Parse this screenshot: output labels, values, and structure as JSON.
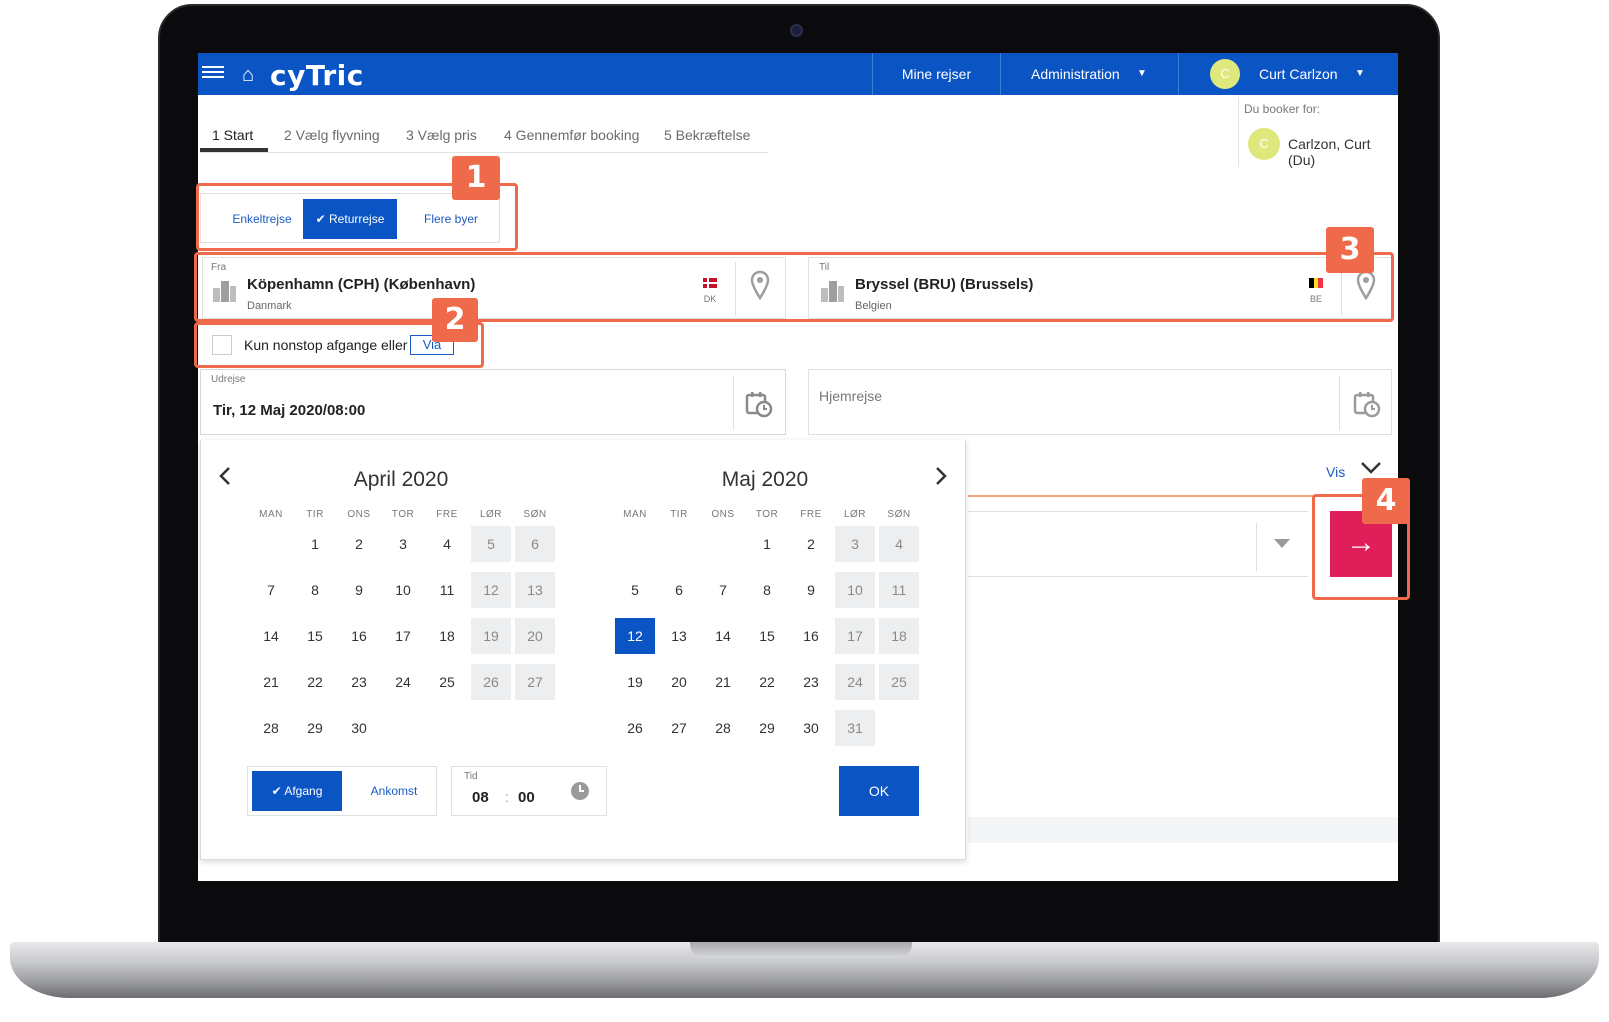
{
  "header": {
    "logo": "cyTric",
    "nav_my_trips": "Mine rejser",
    "nav_admin": "Administration",
    "user_name": "Curt Carlzon",
    "user_initial": "C"
  },
  "steps": [
    {
      "label": "1 Start"
    },
    {
      "label": "2 Vælg flyvning"
    },
    {
      "label": "3 Vælg pris"
    },
    {
      "label": "4 Gennemfør booking"
    },
    {
      "label": "5 Bekræftelse"
    }
  ],
  "booker": {
    "label": "Du booker for:",
    "initial": "C",
    "name": "Carlzon, Curt (Du)"
  },
  "trip_type": {
    "one_way": "Enkeltrejse",
    "return": "Returrejse",
    "multi_city": "Flere byer",
    "selected": "Returrejse"
  },
  "from": {
    "label": "Fra",
    "name": "Köpenhamn (CPH) (København)",
    "country": "Danmark",
    "flag_code": "DK"
  },
  "to": {
    "label": "Til",
    "name": "Bryssel (BRU) (Brussels)",
    "country": "Belgien",
    "flag_code": "BE"
  },
  "nonstop": {
    "label": "Kun nonstop afgange",
    "or_text": "eller",
    "via_label": "Via",
    "checked": false
  },
  "departure": {
    "label": "Udrejse",
    "value": "Tir, 12 Maj 2020/08:00"
  },
  "return_date": {
    "placeholder": "Hjemrejse"
  },
  "options": {
    "vis_label": "Vis"
  },
  "calendar": {
    "weekdays": [
      "MAN",
      "TIR",
      "ONS",
      "TOR",
      "FRE",
      "LØR",
      "SØN"
    ],
    "months": [
      {
        "title": "April 2020",
        "first_weekday": 2,
        "days": 30
      },
      {
        "title": "Maj 2020",
        "first_weekday": 4,
        "days": 31
      }
    ],
    "selected_month": 1,
    "selected_day": 12,
    "mode": {
      "departure": "Afgang",
      "arrival": "Ankomst",
      "selected": "Afgang"
    },
    "time": {
      "label": "Tid",
      "hours": "08",
      "minutes": "00"
    },
    "ok_label": "OK"
  },
  "annotations": [
    "1",
    "2",
    "3",
    "4"
  ],
  "colors": {
    "primary": "#0a54c4",
    "search_button": "#e01e5a",
    "annotation": "#ef6a4a"
  },
  "icons": {
    "menu": "menu-icon",
    "home": "home-icon",
    "pin": "map-pin-icon",
    "calendar": "calendar-clock-icon",
    "clock": "clock-icon",
    "search": "arrow-right-icon"
  }
}
